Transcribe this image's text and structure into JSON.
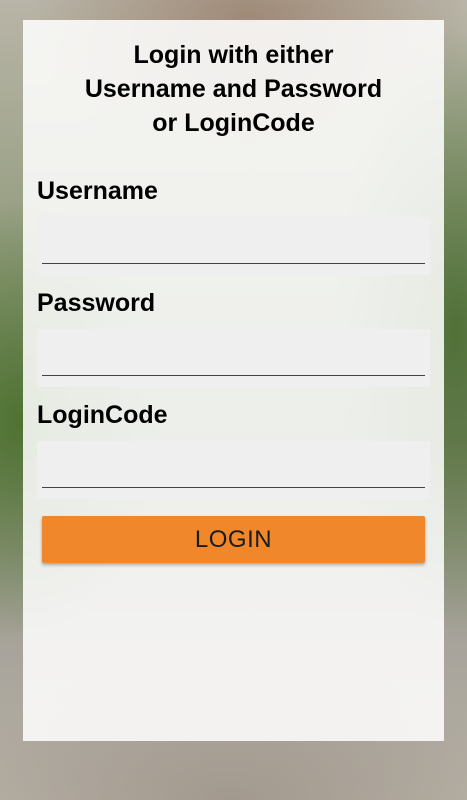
{
  "login": {
    "title_line1": "Login with either",
    "title_line2": "Username and Password",
    "title_line3": "or LoginCode",
    "username_label": "Username",
    "username_value": "",
    "password_label": "Password",
    "password_value": "",
    "logincode_label": "LoginCode",
    "logincode_value": "",
    "button_label": "LOGIN"
  },
  "colors": {
    "button": "#f0872b",
    "field_background": "#efefef"
  }
}
